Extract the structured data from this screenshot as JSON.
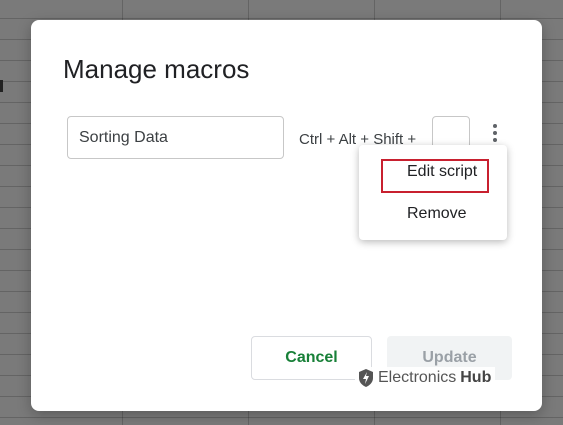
{
  "dialog": {
    "title": "Manage macros",
    "macro_name_value": "Sorting Data",
    "shortcut_label": "Ctrl + Alt + Shift +",
    "shortcut_key_value": ""
  },
  "menu": {
    "items": [
      {
        "label": "Edit script",
        "highlighted": true
      },
      {
        "label": "Remove",
        "highlighted": false
      }
    ]
  },
  "buttons": {
    "cancel_label": "Cancel",
    "update_label": "Update"
  },
  "watermark": {
    "brand": "Electronics",
    "brand_bold": "Hub"
  },
  "colors": {
    "accent_green": "#188038",
    "highlight_red": "#c8202f",
    "disabled_text": "#9aa0a6"
  }
}
